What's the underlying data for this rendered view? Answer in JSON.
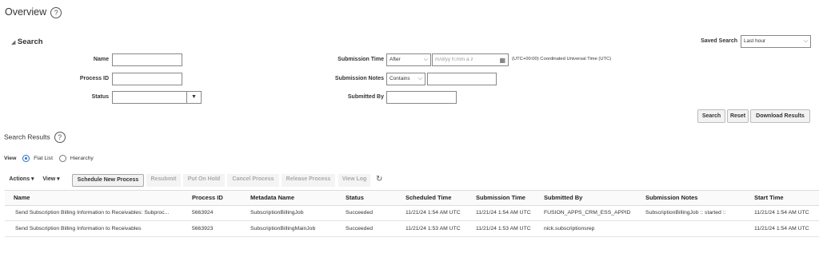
{
  "page": {
    "title": "Overview"
  },
  "search": {
    "heading": "Search",
    "saved_search_label": "Saved Search",
    "saved_search_value": "Last hour",
    "name_label": "Name",
    "name_value": "",
    "process_id_label": "Process ID",
    "process_id_value": "",
    "status_label": "Status",
    "status_value": "",
    "submission_time_label": "Submission Time",
    "submission_time_operator": "After",
    "submission_time_placeholder": "m/d/yy h:mm a z",
    "timezone_note": "(UTC+00:00) Coordinated Universal Time (UTC)",
    "submission_notes_label": "Submission Notes",
    "submission_notes_operator": "Contains",
    "submission_notes_value": "",
    "submitted_by_label": "Submitted By",
    "submitted_by_value": "",
    "buttons": {
      "search": "Search",
      "reset": "Reset",
      "download": "Download Results"
    }
  },
  "results": {
    "heading": "Search Results",
    "view_label": "View",
    "view_options": {
      "flat": "Flat List",
      "hierarchy": "Hierarchy"
    },
    "toolbar": {
      "actions": "Actions ▾",
      "view": "View ▾",
      "schedule": "Schedule New Process",
      "resubmit": "Resubmit",
      "put_on_hold": "Put On Hold",
      "cancel": "Cancel Process",
      "release": "Release Process",
      "view_log": "View Log"
    },
    "columns": [
      "Name",
      "Process ID",
      "Metadata Name",
      "Status",
      "Scheduled Time",
      "Submission Time",
      "Submitted By",
      "Submission Notes",
      "Start Time"
    ],
    "rows": [
      {
        "name": "Send Subscription Billing Information to Receivables: Subproc...",
        "process_id": "5663924",
        "metadata_name": "SubscriptionBillingJob",
        "status": "Succeeded",
        "scheduled_time": "11/21/24 1:54 AM UTC",
        "submission_time": "11/21/24 1:54 AM UTC",
        "submitted_by": "FUSION_APPS_CRM_ESS_APPID",
        "submission_notes": "SubscriptionBillingJob :: started ::",
        "start_time": "11/21/24 1:54 AM UTC"
      },
      {
        "name": "Send Subscription Billing Information to Receivables",
        "process_id": "5663923",
        "metadata_name": "SubscriptionBillingMainJob",
        "status": "Succeeded",
        "scheduled_time": "11/21/24 1:53 AM UTC",
        "submission_time": "11/21/24 1:53 AM UTC",
        "submitted_by": "nick.subscriptionsrep",
        "submission_notes": "",
        "start_time": "11/21/24 1:54 AM UTC"
      }
    ]
  }
}
